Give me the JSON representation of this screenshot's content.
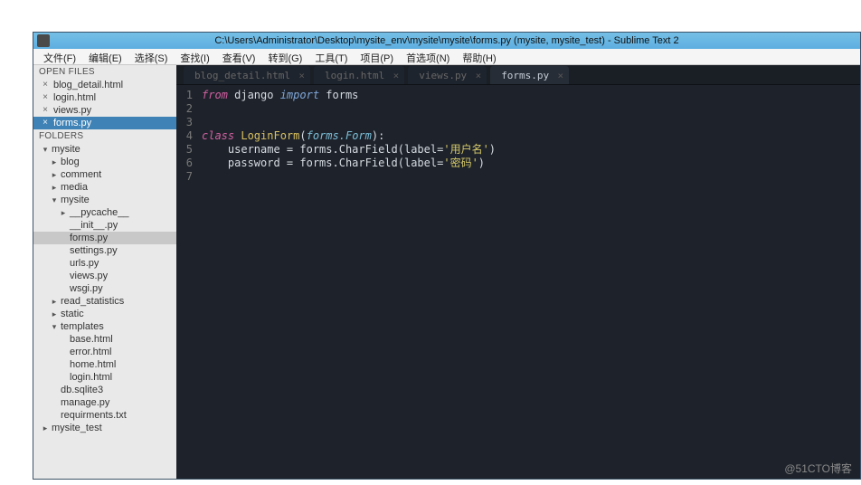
{
  "titlebar": {
    "title": "C:\\Users\\Administrator\\Desktop\\mysite_env\\mysite\\mysite\\forms.py (mysite, mysite_test) - Sublime Text 2"
  },
  "menu": {
    "items": [
      "文件(F)",
      "编辑(E)",
      "选择(S)",
      "查找(I)",
      "查看(V)",
      "转到(G)",
      "工具(T)",
      "项目(P)",
      "首选项(N)",
      "帮助(H)"
    ]
  },
  "sidebar": {
    "open_files_hdr": "OPEN FILES",
    "open_files": [
      {
        "name": "blog_detail.html",
        "active": false
      },
      {
        "name": "login.html",
        "active": false
      },
      {
        "name": "views.py",
        "active": false
      },
      {
        "name": "forms.py",
        "active": true
      }
    ],
    "folders_hdr": "FOLDERS",
    "tree": [
      {
        "label": "mysite",
        "indent": 0,
        "arrow": "down"
      },
      {
        "label": "blog",
        "indent": 1,
        "arrow": "right"
      },
      {
        "label": "comment",
        "indent": 1,
        "arrow": "right"
      },
      {
        "label": "media",
        "indent": 1,
        "arrow": "right"
      },
      {
        "label": "mysite",
        "indent": 1,
        "arrow": "down"
      },
      {
        "label": "__pycache__",
        "indent": 2,
        "arrow": "right"
      },
      {
        "label": "__init__.py",
        "indent": 2,
        "arrow": ""
      },
      {
        "label": "forms.py",
        "indent": 2,
        "arrow": "",
        "sel": true
      },
      {
        "label": "settings.py",
        "indent": 2,
        "arrow": ""
      },
      {
        "label": "urls.py",
        "indent": 2,
        "arrow": ""
      },
      {
        "label": "views.py",
        "indent": 2,
        "arrow": ""
      },
      {
        "label": "wsgi.py",
        "indent": 2,
        "arrow": ""
      },
      {
        "label": "read_statistics",
        "indent": 1,
        "arrow": "right"
      },
      {
        "label": "static",
        "indent": 1,
        "arrow": "right"
      },
      {
        "label": "templates",
        "indent": 1,
        "arrow": "down"
      },
      {
        "label": "base.html",
        "indent": 2,
        "arrow": ""
      },
      {
        "label": "error.html",
        "indent": 2,
        "arrow": ""
      },
      {
        "label": "home.html",
        "indent": 2,
        "arrow": ""
      },
      {
        "label": "login.html",
        "indent": 2,
        "arrow": ""
      },
      {
        "label": "db.sqlite3",
        "indent": 1,
        "arrow": ""
      },
      {
        "label": "manage.py",
        "indent": 1,
        "arrow": ""
      },
      {
        "label": "requirments.txt",
        "indent": 1,
        "arrow": ""
      },
      {
        "label": "mysite_test",
        "indent": 0,
        "arrow": "right"
      }
    ]
  },
  "tabs": [
    {
      "label": "blog_detail.html",
      "active": false
    },
    {
      "label": "login.html",
      "active": false
    },
    {
      "label": "views.py",
      "active": false
    },
    {
      "label": "forms.py",
      "active": true
    }
  ],
  "code": {
    "line_count": 7,
    "tokens": [
      [
        [
          "kw",
          "from"
        ],
        [
          "",
          " django "
        ],
        [
          "imp",
          "import"
        ],
        [
          "",
          " forms"
        ]
      ],
      [],
      [],
      [
        [
          "kw",
          "class "
        ],
        [
          "cls",
          "LoginForm"
        ],
        [
          "punct",
          "("
        ],
        [
          "param",
          "forms.Form"
        ],
        [
          "punct",
          "):"
        ]
      ],
      [
        [
          "",
          "    username "
        ],
        [
          "punct",
          "="
        ],
        [
          "",
          " forms.CharField"
        ],
        [
          "punct",
          "("
        ],
        [
          "",
          "label"
        ],
        [
          "punct",
          "="
        ],
        [
          "str",
          "'用户名'"
        ],
        [
          "punct",
          ")"
        ]
      ],
      [
        [
          "",
          "    password "
        ],
        [
          "punct",
          "="
        ],
        [
          "",
          " forms.CharField"
        ],
        [
          "punct",
          "("
        ],
        [
          "",
          "label"
        ],
        [
          "punct",
          "="
        ],
        [
          "str",
          "'密码'"
        ],
        [
          "punct",
          ")"
        ]
      ],
      []
    ]
  },
  "watermark": "@51CTO博客"
}
